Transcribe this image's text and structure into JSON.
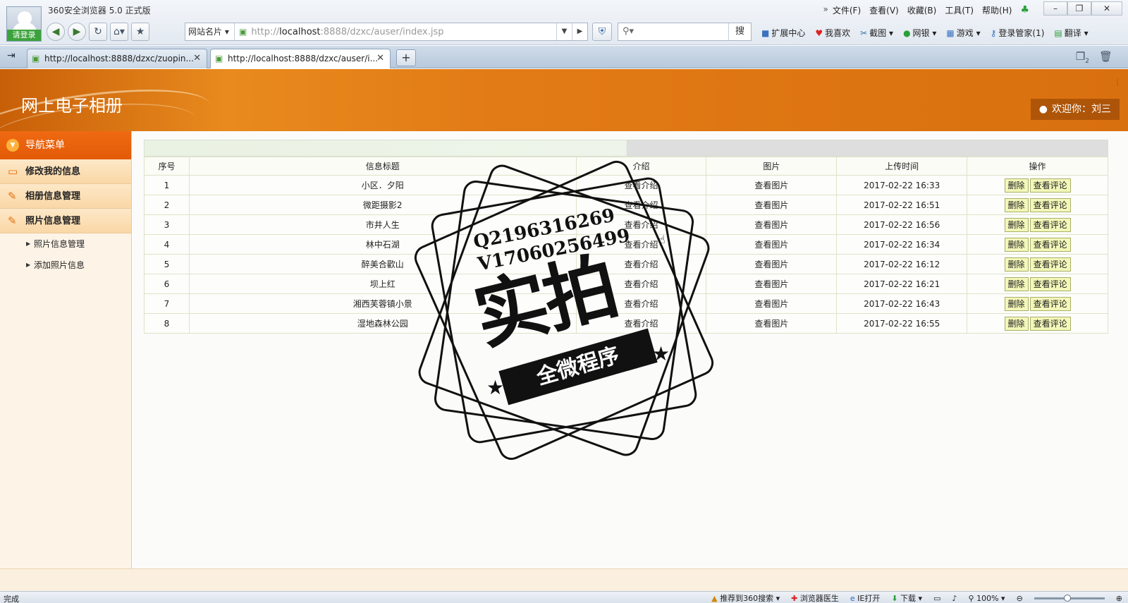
{
  "browser": {
    "title": "360安全浏览器 5.0 正式版",
    "login_label": "请登录",
    "menus": [
      "文件(F)",
      "查看(V)",
      "收藏(B)",
      "工具(T)",
      "帮助(H)"
    ],
    "site_cards": "网站名片",
    "url_prefix": "http://",
    "url_host": "localhost",
    "url_rest": ":8888/dzxc/auser/index.jsp",
    "search_button": "搜",
    "toolbar_links": [
      "扩展中心",
      "我喜欢",
      "截图",
      "网银",
      "游戏",
      "登录管家(1)",
      "翻译"
    ],
    "tabs": [
      {
        "label": "http://localhost:8888/dzxc/zuopin..."
      },
      {
        "label": "http://localhost:8888/dzxc/auser/i..."
      }
    ],
    "tab_count_badge": "2",
    "status": {
      "left": "完成",
      "items": [
        "推荐到360搜索",
        "浏览器医生",
        "IE打开",
        "下载"
      ],
      "zoom": "100%"
    }
  },
  "header": {
    "site_title": "网上电子相册",
    "welcome": "欢迎你：刘三"
  },
  "sidebar": {
    "nav_title": "导航菜单",
    "items": [
      {
        "label": "修改我的信息"
      },
      {
        "label": "相册信息管理"
      },
      {
        "label": "照片信息管理"
      }
    ],
    "sub_items": [
      {
        "label": "照片信息管理"
      },
      {
        "label": "添加照片信息"
      }
    ]
  },
  "table": {
    "headers": [
      "序号",
      "信息标题",
      "介绍",
      "图片",
      "上传时间",
      "操作"
    ],
    "intro_link": "查看介绍",
    "image_link": "查看图片",
    "delete_label": "删除",
    "comment_label": "查看评论",
    "rows": [
      {
        "no": "1",
        "title": "小区．夕阳",
        "time": "2017-02-22 16:33"
      },
      {
        "no": "2",
        "title": "微距摄影2",
        "time": "2017-02-22 16:51"
      },
      {
        "no": "3",
        "title": "市井人生",
        "time": "2017-02-22 16:56"
      },
      {
        "no": "4",
        "title": "林中石湖",
        "time": "2017-02-22 16:34"
      },
      {
        "no": "5",
        "title": "醉美合歡山",
        "time": "2017-02-22 16:12"
      },
      {
        "no": "6",
        "title": "坝上红",
        "time": "2017-02-22 16:21"
      },
      {
        "no": "7",
        "title": "湘西芙蓉镇小景",
        "time": "2017-02-22 16:43"
      },
      {
        "no": "8",
        "title": "湿地森林公园",
        "time": "2017-02-22 16:55"
      }
    ]
  },
  "watermark": {
    "line1": "Q2196316269",
    "line2": "V17060256499",
    "big": "实拍",
    "ribbon": "全微程序"
  }
}
